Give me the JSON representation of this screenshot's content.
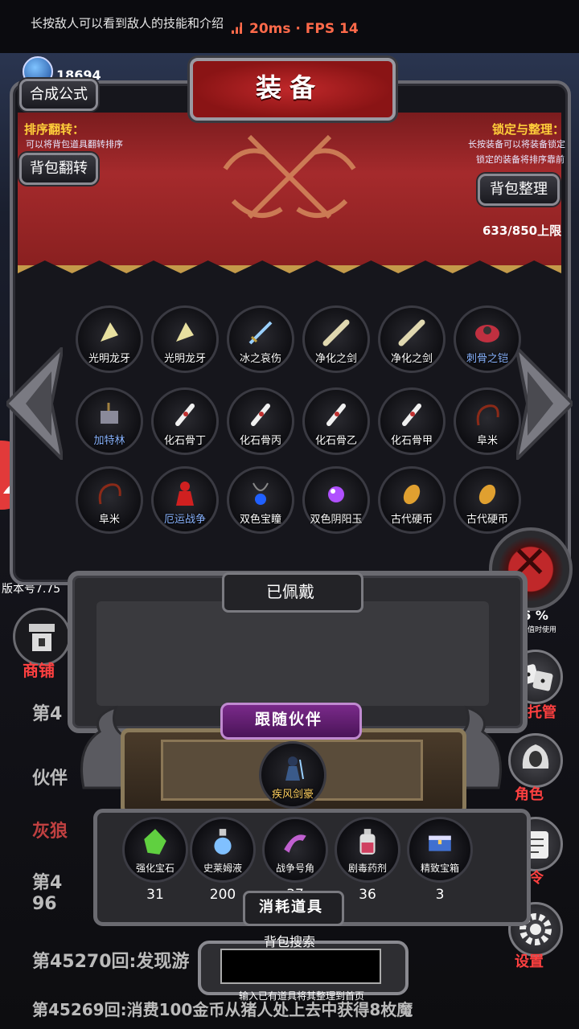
{
  "top": {
    "hint": "长按敌人可以看到敌人的技能和介绍",
    "ping": "20ms",
    "fps": "FPS 14",
    "net_text": "20ms · FPS 14"
  },
  "gems": {
    "count": "18694"
  },
  "panel": {
    "title": "装备",
    "formula_button": "合成公式",
    "sort_title": "排序翻转：",
    "sort_note": "可以将背包道具翻转排序",
    "flip_button": "背包翻转",
    "lock_title": "锁定与整理：",
    "lock_note1": "长按装备可以将装备锁定",
    "lock_note2": "锁定的装备将排序靠前",
    "tidy_button": "背包整理",
    "capacity": "633/850上限"
  },
  "items": [
    {
      "label": "光明龙牙",
      "icon": "bone-fang-icon",
      "color": "#e8e0a0"
    },
    {
      "label": "光明龙牙",
      "icon": "bone-fang-icon",
      "color": "#e8e0a0"
    },
    {
      "label": "冰之哀伤",
      "icon": "ice-sword-icon",
      "color": "#9ad0ff"
    },
    {
      "label": "净化之剑",
      "icon": "sword-icon",
      "color": "#e0d8b0"
    },
    {
      "label": "净化之剑",
      "icon": "sword-icon",
      "color": "#e0d8b0"
    },
    {
      "label": "刺骨之铠",
      "icon": "armor-icon",
      "color": "#c03040",
      "blue": true
    },
    {
      "label": "加特林",
      "icon": "gatling-icon",
      "color": "#8a8a9a",
      "blue": true
    },
    {
      "label": "化石骨丁",
      "icon": "bone-icon",
      "color": "#f0f0f0"
    },
    {
      "label": "化石骨丙",
      "icon": "bone-icon",
      "color": "#f0f0f0"
    },
    {
      "label": "化石骨乙",
      "icon": "bone-icon",
      "color": "#f0f0f0"
    },
    {
      "label": "化石骨甲",
      "icon": "bone-icon",
      "color": "#f0f0f0"
    },
    {
      "label": "阜米",
      "icon": "whip-icon",
      "color": "#8a2a18"
    },
    {
      "label": "阜米",
      "icon": "whip-icon",
      "color": "#8a2a18"
    },
    {
      "label": "厄运战争",
      "icon": "red-warrior-icon",
      "color": "#d02020",
      "blue": true
    },
    {
      "label": "双色宝瞳",
      "icon": "amulet-icon",
      "color": "#2060ff"
    },
    {
      "label": "双色阴阳玉",
      "icon": "orb-icon",
      "color": "#b050ff"
    },
    {
      "label": "古代硬币",
      "icon": "coin-icon",
      "color": "#e0a030"
    },
    {
      "label": "古代硬币",
      "icon": "coin-icon",
      "color": "#e0a030"
    }
  ],
  "worn": {
    "title": "已佩戴"
  },
  "companion": {
    "title": "跟随伙伴",
    "name": "疾风剑豪"
  },
  "consumables": {
    "title": "消耗道具",
    "items": [
      {
        "label": "强化宝石",
        "count": "31",
        "icon": "green-gem-icon",
        "color": "#60d040"
      },
      {
        "label": "史莱姆液",
        "count": "200",
        "icon": "potion-icon",
        "color": "#80c0ff"
      },
      {
        "label": "战争号角",
        "count": "37",
        "icon": "horn-icon",
        "color": "#c060d0"
      },
      {
        "label": "剧毒药剂",
        "count": "36",
        "icon": "poison-icon",
        "color": "#d04060"
      },
      {
        "label": "精致宝箱",
        "count": "3",
        "icon": "chest-icon",
        "color": "#4070d0"
      }
    ]
  },
  "search": {
    "label": "背包搜索",
    "hint": "输入已有道具将其整理到首页"
  },
  "side": {
    "close": "✕",
    "stat": "56 %",
    "stat_note": "其数值时使用",
    "dice_label": "托管",
    "role_label": "角色",
    "code_label": "口令",
    "settings_label": "设置"
  },
  "left": {
    "shop_label": "商铺",
    "version": "版本号7.75"
  },
  "logs": [
    "第4",
    "伙伴",
    "灰狼",
    "第4",
    "96",
    "第45270回:发现游",
    "第45269回:消费100金币从猪人处上去中获得8枚魔"
  ]
}
